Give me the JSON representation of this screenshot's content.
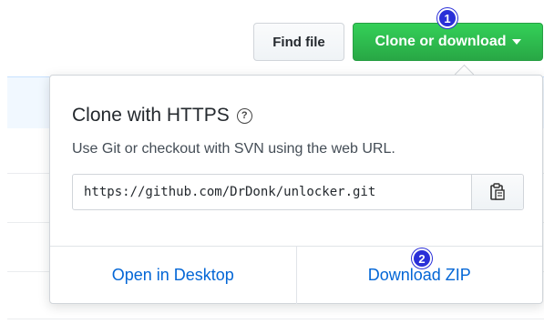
{
  "toolbar": {
    "find_file_label": "Find file",
    "clone_label": "Clone or download"
  },
  "badges": {
    "first": "1",
    "second": "2"
  },
  "clone_popover": {
    "title": "Clone with HTTPS",
    "help_glyph": "?",
    "description": "Use Git or checkout with SVN using the web URL.",
    "url_value": "https://github.com/DrDonk/unlocker.git",
    "open_desktop_label": "Open in Desktop",
    "download_zip_label": "Download ZIP"
  },
  "colors": {
    "accent_green": "#28a745",
    "link_blue": "#0366d6",
    "badge_blue": "#2a2fd8"
  },
  "icons": [
    "help-icon",
    "clipboard-icon",
    "caret-down-icon"
  ]
}
